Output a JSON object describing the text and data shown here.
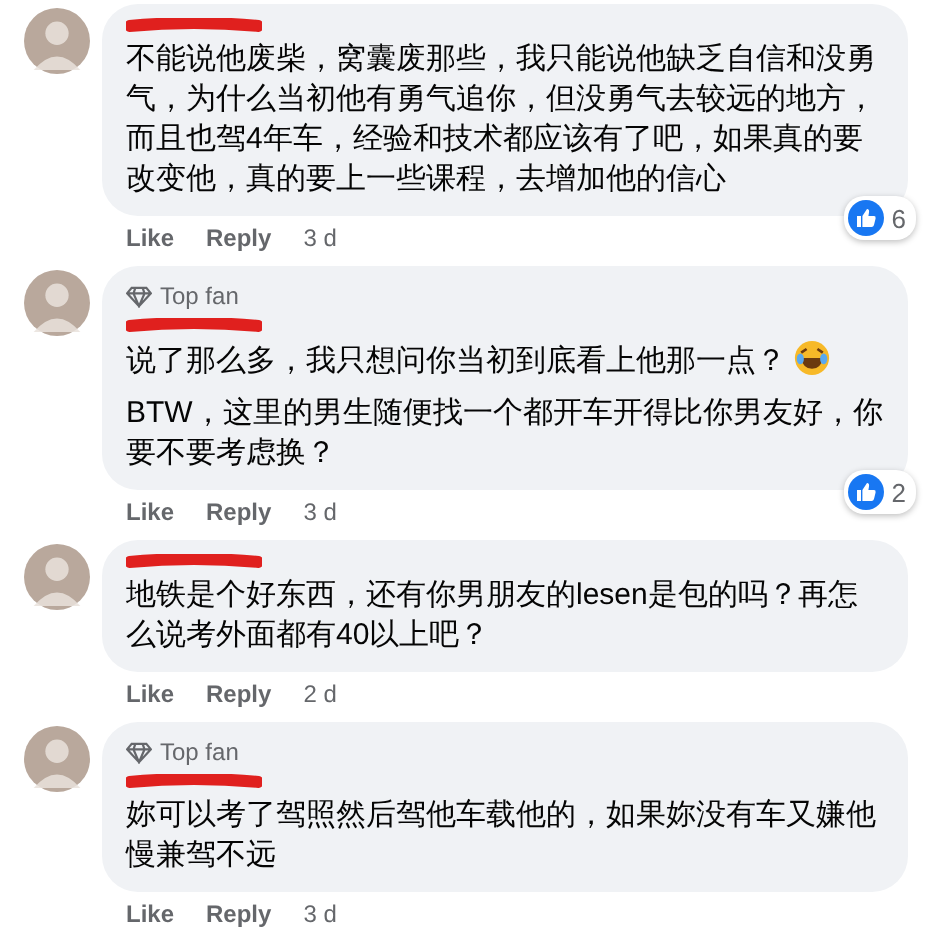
{
  "comments": [
    {
      "paragraphs": [
        {
          "text": "不能说他废柴，窝囊废那些，我只能说他缺乏自信和没勇气，为什么当初他有勇气追你，但没勇气去较远的地方，而且也驾4年车，经验和技术都应该有了吧，如果真的要改变他，真的要上一些课程，去增加他的信心"
        }
      ],
      "reactions": "6",
      "like": "Like",
      "reply": "Reply",
      "time": "3 d"
    },
    {
      "badge": "Top fan",
      "paragraphs": [
        {
          "text": "说了那么多，我只想问你当初到底看上他那一点？",
          "emoji": true
        },
        {
          "text": "BTW，这里的男生随便找一个都开车开得比你男友好，你要不要考虑换？"
        }
      ],
      "reactions": "2",
      "like": "Like",
      "reply": "Reply",
      "time": "3 d"
    },
    {
      "paragraphs": [
        {
          "text": "地铁是个好东西，还有你男朋友的lesen是包的吗？再怎么说考外面都有40以上吧？"
        }
      ],
      "like": "Like",
      "reply": "Reply",
      "time": "2 d"
    },
    {
      "badge": "Top fan",
      "paragraphs": [
        {
          "text": "妳可以考了驾照然后驾他车载他的，如果妳没有车又嫌他慢兼驾不远"
        }
      ],
      "like": "Like",
      "reply": "Reply",
      "time": "3 d"
    }
  ]
}
